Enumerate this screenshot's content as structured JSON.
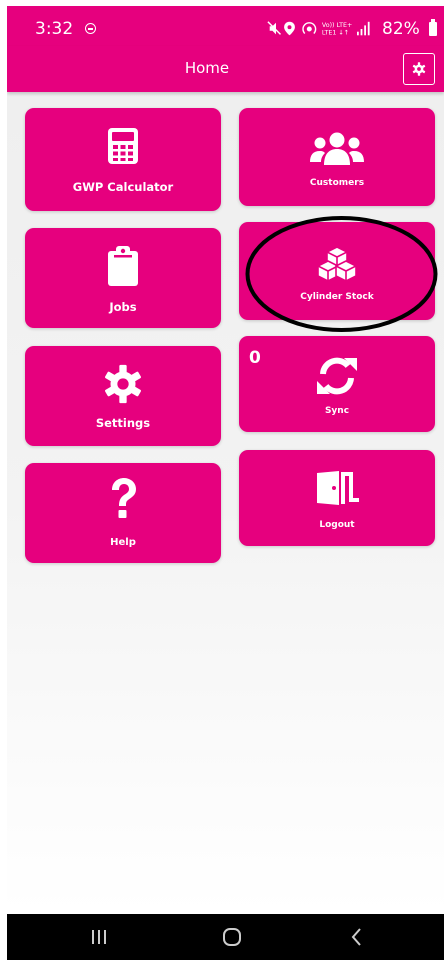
{
  "status_bar": {
    "time": "3:32",
    "network_text_top": "Vo)) LTE+",
    "network_text_bottom": "LTE1 ↓↑",
    "battery": "82%"
  },
  "app_bar": {
    "title": "Home",
    "settings_icon": "gear-icon"
  },
  "tiles": [
    {
      "label": "GWP Calculator",
      "icon": "calculator-icon"
    },
    {
      "label": "Customers",
      "icon": "users-icon"
    },
    {
      "label": "Jobs",
      "icon": "clipboard-icon"
    },
    {
      "label": "Cylinder Stock",
      "icon": "cubes-icon"
    },
    {
      "label": "Settings",
      "icon": "gear-icon"
    },
    {
      "label": "Sync",
      "icon": "sync-icon",
      "count": "0"
    },
    {
      "label": "Help",
      "icon": "question-icon"
    },
    {
      "label": "Logout",
      "icon": "door-exit-icon"
    }
  ],
  "nav_bar": {
    "buttons": [
      "recent-apps-icon",
      "home-icon",
      "back-icon"
    ]
  },
  "colors": {
    "brand": "#e6007e",
    "background": "#f0f0f0",
    "nav_bar": "#000000"
  }
}
